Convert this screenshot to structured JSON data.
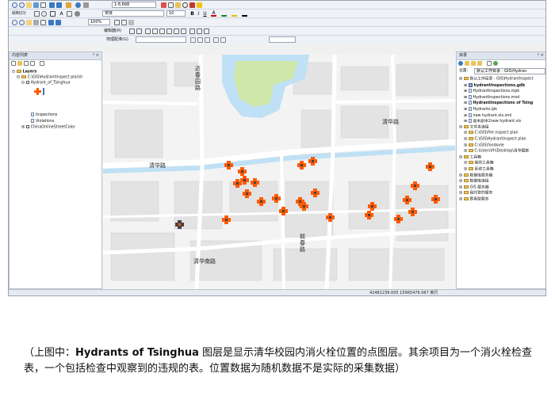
{
  "toolbar": {
    "scale_value": "1:6,668",
    "draw_menu": "绘制(D)",
    "font_name": "宋体",
    "font_size": "10",
    "zoom_percent": "100%",
    "edit_menu": "编辑器(R)",
    "georef_menu": "地理配准(G)",
    "georef_layer": ""
  },
  "toc": {
    "title": "内容列表",
    "layers_label": "Layers",
    "folder_label": "C:\\GIS\\HydrantInspect plan\\h",
    "hydrant_layer": "Hydrant_of_Tsinghua",
    "inspections": "Inspections",
    "violations": "Violations",
    "basemap": "ChinaOnlineStreetColor"
  },
  "catalog": {
    "title": "目录",
    "location_label": "位置:",
    "location_value": "默认工作目录 - GIS\\Hydran",
    "items": [
      {
        "label": "默认工作目录 - GIS\\HydrantInspect",
        "bold": false,
        "icon": "folder"
      },
      {
        "label": "hydrantInspections.gdb",
        "bold": true,
        "icon": "gdb"
      },
      {
        "label": "HydrantInspections.mpk",
        "bold": false,
        "icon": "file"
      },
      {
        "label": "HydrantInspections.mxd",
        "bold": false,
        "icon": "file"
      },
      {
        "label": "HydrantInspections of Tsing",
        "bold": true,
        "icon": "file"
      },
      {
        "label": "Hydrants.lpk",
        "bold": false,
        "icon": "file"
      },
      {
        "label": "new hydrant.xls.xml",
        "bold": false,
        "icon": "file"
      },
      {
        "label": "副本副本2new hydrant.xls",
        "bold": false,
        "icon": "file"
      },
      {
        "label": "文件夹连接",
        "bold": false,
        "icon": "folder"
      },
      {
        "label": "C:\\GIS\\fire inspect plan",
        "bold": false,
        "icon": "folder"
      },
      {
        "label": "C:\\GIS\\HydrantInspect plan",
        "bold": false,
        "icon": "folder"
      },
      {
        "label": "C:\\GIS\\fondovle",
        "bold": false,
        "icon": "folder"
      },
      {
        "label": "C:\\Users\\fh\\Desktop\\清华图旅",
        "bold": false,
        "icon": "folder"
      },
      {
        "label": "工具箱",
        "bold": false,
        "icon": "folder"
      },
      {
        "label": "我的工具箱",
        "bold": false,
        "icon": "folder"
      },
      {
        "label": "系统工具箱",
        "bold": false,
        "icon": "folder"
      },
      {
        "label": "数据库服务器",
        "bold": false,
        "icon": "folder"
      },
      {
        "label": "数据库连接",
        "bold": false,
        "icon": "folder"
      },
      {
        "label": "GIS 服务器",
        "bold": false,
        "icon": "folder"
      },
      {
        "label": "我托管的服务",
        "bold": false,
        "icon": "folder"
      },
      {
        "label": "即用型服务",
        "bold": false,
        "icon": "folder"
      }
    ]
  },
  "map": {
    "road_labels": {
      "qinghua_right": "清华路",
      "qinghua_left": "清华路",
      "qingnan": "清华南路",
      "vertical_north": "近春园路",
      "vertical_south": "熙春路"
    }
  },
  "status": {
    "coords": "424812​39.005  15965476.067 英尺"
  },
  "caption": {
    "prefix": "（上图中：",
    "layer_name": "Hydrants of Tsinghua",
    "rest": " 图层是显示清华校园内消火栓位置的点图层。其余项目为一个消火栓检查表，一个包括检查中观察到的违规的表。位置数据为随机数据不是实际的采集数据）"
  },
  "colors": {
    "hydrant_orange": "#ff5a00",
    "hydrant_dark": "#444444",
    "water_blue": "#bfe0f5",
    "park_green": "#cfe7a8",
    "road_white": "#ffffff",
    "block_grey": "#e3e3e3"
  }
}
